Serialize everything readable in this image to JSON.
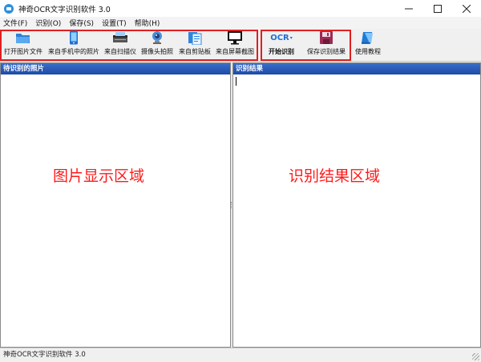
{
  "window": {
    "title": "神奇OCR文字识别软件 3.0",
    "controls": [
      "minimize-icon",
      "maximize-icon",
      "close-icon"
    ]
  },
  "menu": [
    {
      "label": "文件(F)"
    },
    {
      "label": "识别(O)"
    },
    {
      "label": "保存(S)"
    },
    {
      "label": "设置(T)"
    },
    {
      "label": "帮助(H)"
    }
  ],
  "toolbar": {
    "open_image": {
      "label": "打开图片文件",
      "icon": "folder-open-icon"
    },
    "from_phone": {
      "label": "来自手机中的照片",
      "icon": "phone-icon"
    },
    "from_scanner": {
      "label": "来自扫描仪",
      "icon": "scanner-icon"
    },
    "from_camera": {
      "label": "摄像头拍照",
      "icon": "webcam-icon"
    },
    "from_clipboard": {
      "label": "来自剪贴板",
      "icon": "clipboard-icon"
    },
    "screenshot": {
      "label": "来自屏幕截图",
      "icon": "monitor-icon"
    },
    "start_ocr": {
      "label": "开始识别",
      "icon": "ocr-icon",
      "icon_text": "OCR"
    },
    "save_result": {
      "label": "保存识别结果",
      "icon": "floppy-disk-icon"
    },
    "tutorial": {
      "label": "使用教程",
      "icon": "book-icon"
    }
  },
  "left_panel": {
    "header": "待识别的照片",
    "area_label": "图片显示区域"
  },
  "right_panel": {
    "header": "识别结果",
    "area_label": "识别结果区域"
  },
  "statusbar": {
    "text": "神奇OCR文字识别软件 3.0"
  },
  "colors": {
    "panel_header": "#2558b8",
    "highlight_border": "#e02020",
    "area_label": "#ff1a1a"
  }
}
